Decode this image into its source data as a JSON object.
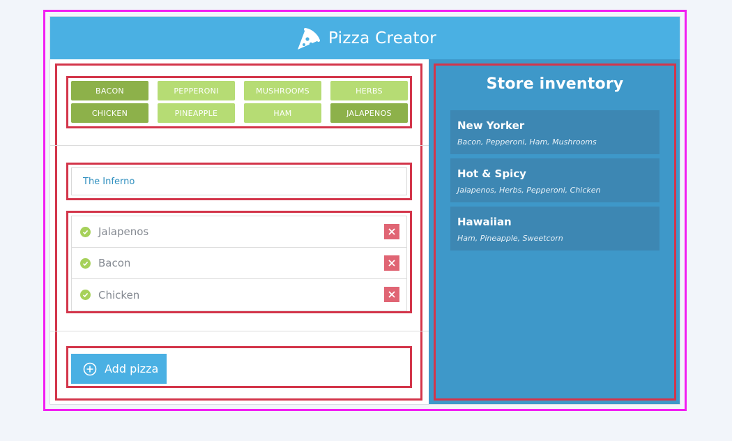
{
  "header": {
    "title": "Pizza Creator",
    "logo_icon": "pizza-slice-icon"
  },
  "toppings": [
    {
      "label": "BACON",
      "selected": true
    },
    {
      "label": "PEPPERONI",
      "selected": false
    },
    {
      "label": "MUSHROOMS",
      "selected": false
    },
    {
      "label": "HERBS",
      "selected": false
    },
    {
      "label": "CHICKEN",
      "selected": true
    },
    {
      "label": "PINEAPPLE",
      "selected": false
    },
    {
      "label": "HAM",
      "selected": false
    },
    {
      "label": "JALAPENOS",
      "selected": true
    }
  ],
  "pizza_name": {
    "value": "The Inferno"
  },
  "selected_toppings": [
    {
      "name": "Jalapenos"
    },
    {
      "name": "Bacon"
    },
    {
      "name": "Chicken"
    }
  ],
  "add_button": {
    "label": "Add pizza",
    "icon": "plus-circle-icon"
  },
  "inventory": {
    "title": "Store inventory",
    "items": [
      {
        "name": "New Yorker",
        "toppings": "Bacon, Pepperoni, Ham, Mushrooms"
      },
      {
        "name": "Hot & Spicy",
        "toppings": "Jalapenos, Herbs, Pepperoni, Chicken"
      },
      {
        "name": "Hawaiian",
        "toppings": "Ham, Pineapple, Sweetcorn"
      }
    ]
  },
  "colors": {
    "header": "#4ab0e3",
    "topping_selected": "#8db14a",
    "topping_unselected": "#b6dc74",
    "remove": "#e06574",
    "inventory_bg": "#3e98c9",
    "highlight_red": "#d3354a",
    "highlight_magenta": "#f21ef2"
  }
}
